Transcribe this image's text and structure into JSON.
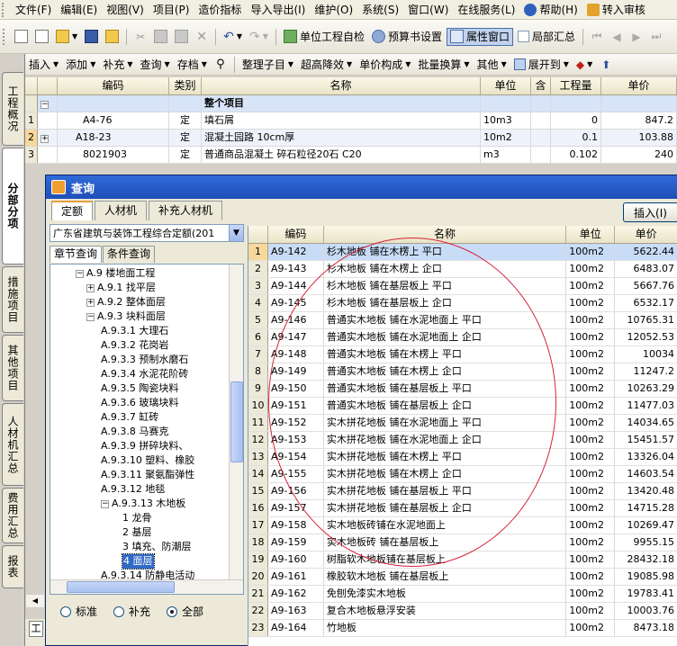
{
  "menu": {
    "items": [
      "文件(F)",
      "编辑(E)",
      "视图(V)",
      "项目(P)",
      "造价指标",
      "导入导出(I)",
      "维护(O)",
      "系统(S)",
      "窗口(W)",
      "在线服务(L)",
      "帮助(H)",
      "转入审核"
    ]
  },
  "toolbar1": {
    "check_label": "单位工程自检",
    "budget_label": "预算书设置",
    "property_label": "属性窗口",
    "local_summary_label": "局部汇总"
  },
  "toolbar2": {
    "items": [
      "插入",
      "添加",
      "补充",
      "查询",
      "存档",
      "整理子目",
      "超高降效",
      "单价构成",
      "批量换算",
      "其他",
      "展开到"
    ]
  },
  "vertical_tabs": [
    "工程概况",
    "分部分项",
    "措施项目",
    "其他项目",
    "人材机汇总",
    "费用汇总",
    "报表"
  ],
  "main_grid": {
    "headers": [
      "",
      "",
      "编码",
      "类别",
      "名称",
      "单位",
      "含",
      "工程量",
      "单价"
    ],
    "section_label": "整个项目",
    "section_toggle": "−",
    "rows": [
      {
        "n": "1",
        "code": "A4-76",
        "type": "定",
        "name": "填石屑",
        "unit": "10m3",
        "qty": "0",
        "price": "847.2",
        "expand": ""
      },
      {
        "n": "2",
        "code": "A18-23",
        "type": "定",
        "name": "混凝土园路 10cm厚",
        "unit": "10m2",
        "qty": "0.1",
        "price": "103.88",
        "expand": "+"
      },
      {
        "n": "3",
        "code": "8021903",
        "type": "定",
        "name": "普通商品混凝土 碎石粒径20石 C20",
        "unit": "m3",
        "qty": "0.102",
        "price": "240",
        "expand": ""
      }
    ]
  },
  "dialog": {
    "title": "查询",
    "tabs": [
      "定额",
      "人材机",
      "补充人材机"
    ],
    "insert_label": "插入(I)",
    "quota_combo": "广东省建筑与装饰工程综合定额(201",
    "search_tabs": [
      "章节查询",
      "条件查询"
    ],
    "tree": [
      {
        "label": "A.9 楼地面工程",
        "level": 0,
        "toggle": "−"
      },
      {
        "label": "A.9.1 找平层",
        "level": 1,
        "toggle": "+"
      },
      {
        "label": "A.9.2 整体面层",
        "level": 1,
        "toggle": "+"
      },
      {
        "label": "A.9.3 块料面层",
        "level": 1,
        "toggle": "−"
      },
      {
        "label": "A.9.3.1 大理石",
        "level": 2,
        "toggle": ""
      },
      {
        "label": "A.9.3.2 花岗岩",
        "level": 2,
        "toggle": ""
      },
      {
        "label": "A.9.3.3 预制水磨石",
        "level": 2,
        "toggle": ""
      },
      {
        "label": "A.9.3.4 水泥花阶砖",
        "level": 2,
        "toggle": ""
      },
      {
        "label": "A.9.3.5 陶瓷块料",
        "level": 2,
        "toggle": ""
      },
      {
        "label": "A.9.3.6 玻璃块料",
        "level": 2,
        "toggle": ""
      },
      {
        "label": "A.9.3.7 缸砖",
        "level": 2,
        "toggle": ""
      },
      {
        "label": "A.9.3.8 马赛克",
        "level": 2,
        "toggle": ""
      },
      {
        "label": "A.9.3.9 拼碎块料、",
        "level": 2,
        "toggle": ""
      },
      {
        "label": "A.9.3.10 塑料、橡胶",
        "level": 2,
        "toggle": ""
      },
      {
        "label": "A.9.3.11 聚氨酯弹性",
        "level": 2,
        "toggle": ""
      },
      {
        "label": "A.9.3.12 地毯",
        "level": 2,
        "toggle": ""
      },
      {
        "label": "A.9.3.13 木地板",
        "level": 2,
        "toggle": "−"
      },
      {
        "label": "1 龙骨",
        "level": 3,
        "toggle": ""
      },
      {
        "label": "2 基层",
        "level": 3,
        "toggle": ""
      },
      {
        "label": "3 填充、防潮层",
        "level": 3,
        "toggle": ""
      },
      {
        "label": "4 面层",
        "level": 3,
        "toggle": "",
        "selected": true
      },
      {
        "label": "A.9.3.14 防静电活动",
        "level": 2,
        "toggle": ""
      }
    ],
    "radios": [
      {
        "label": "标准",
        "checked": false
      },
      {
        "label": "补充",
        "checked": false
      },
      {
        "label": "全部",
        "checked": true
      }
    ],
    "grid_headers": [
      "",
      "编码",
      "名称",
      "单位",
      "单价"
    ],
    "grid_rows": [
      {
        "n": "1",
        "code": "A9-142",
        "name": "杉木地板 铺在木楞上 平口",
        "unit": "100m2",
        "price": "5622.44"
      },
      {
        "n": "2",
        "code": "A9-143",
        "name": "杉木地板 铺在木楞上 企口",
        "unit": "100m2",
        "price": "6483.07"
      },
      {
        "n": "3",
        "code": "A9-144",
        "name": "杉木地板 铺在基层板上 平口",
        "unit": "100m2",
        "price": "5667.76"
      },
      {
        "n": "4",
        "code": "A9-145",
        "name": "杉木地板 铺在基层板上 企口",
        "unit": "100m2",
        "price": "6532.17"
      },
      {
        "n": "5",
        "code": "A9-146",
        "name": "普通实木地板 铺在水泥地面上 平口",
        "unit": "100m2",
        "price": "10765.31"
      },
      {
        "n": "6",
        "code": "A9-147",
        "name": "普通实木地板 铺在水泥地面上 企口",
        "unit": "100m2",
        "price": "12052.53"
      },
      {
        "n": "7",
        "code": "A9-148",
        "name": "普通实木地板 铺在木楞上 平口",
        "unit": "100m2",
        "price": "10034"
      },
      {
        "n": "8",
        "code": "A9-149",
        "name": "普通实木地板 铺在木楞上 企口",
        "unit": "100m2",
        "price": "11247.2"
      },
      {
        "n": "9",
        "code": "A9-150",
        "name": "普通实木地板 铺在基层板上 平口",
        "unit": "100m2",
        "price": "10263.29"
      },
      {
        "n": "10",
        "code": "A9-151",
        "name": "普通实木地板 铺在基层板上 企口",
        "unit": "100m2",
        "price": "11477.03"
      },
      {
        "n": "11",
        "code": "A9-152",
        "name": "实木拼花地板 铺在水泥地面上 平口",
        "unit": "100m2",
        "price": "14034.65"
      },
      {
        "n": "12",
        "code": "A9-153",
        "name": "实木拼花地板 铺在水泥地面上 企口",
        "unit": "100m2",
        "price": "15451.57"
      },
      {
        "n": "13",
        "code": "A9-154",
        "name": "实木拼花地板 铺在木楞上 平口",
        "unit": "100m2",
        "price": "13326.04"
      },
      {
        "n": "14",
        "code": "A9-155",
        "name": "实木拼花地板 铺在木楞上 企口",
        "unit": "100m2",
        "price": "14603.54"
      },
      {
        "n": "15",
        "code": "A9-156",
        "name": "实木拼花地板 铺在基层板上 平口",
        "unit": "100m2",
        "price": "13420.48"
      },
      {
        "n": "16",
        "code": "A9-157",
        "name": "实木拼花地板 铺在基层板上 企口",
        "unit": "100m2",
        "price": "14715.28"
      },
      {
        "n": "17",
        "code": "A9-158",
        "name": "实木地板砖铺在水泥地面上",
        "unit": "100m2",
        "price": "10269.47"
      },
      {
        "n": "18",
        "code": "A9-159",
        "name": "实木地板砖 铺在基层板上",
        "unit": "100m2",
        "price": "9955.15"
      },
      {
        "n": "19",
        "code": "A9-160",
        "name": "树脂软木地板铺在基层板上",
        "unit": "100m2",
        "price": "28432.18"
      },
      {
        "n": "20",
        "code": "A9-161",
        "name": "橡胶软木地板 铺在基层板上",
        "unit": "100m2",
        "price": "19085.98"
      },
      {
        "n": "21",
        "code": "A9-162",
        "name": "免刨免漆实木地板",
        "unit": "100m2",
        "price": "19783.41"
      },
      {
        "n": "22",
        "code": "A9-163",
        "name": "复合木地板悬浮安装",
        "unit": "100m2",
        "price": "10003.76"
      },
      {
        "n": "23",
        "code": "A9-164",
        "name": "竹地板",
        "unit": "100m2",
        "price": "8473.18"
      }
    ]
  },
  "bottom_tab_label": "工",
  "colors": {
    "title_bar": "#1f4fb8",
    "selection": "#316ac5",
    "annotation": "#d6223a",
    "row_selected": "#c9dcf7"
  }
}
